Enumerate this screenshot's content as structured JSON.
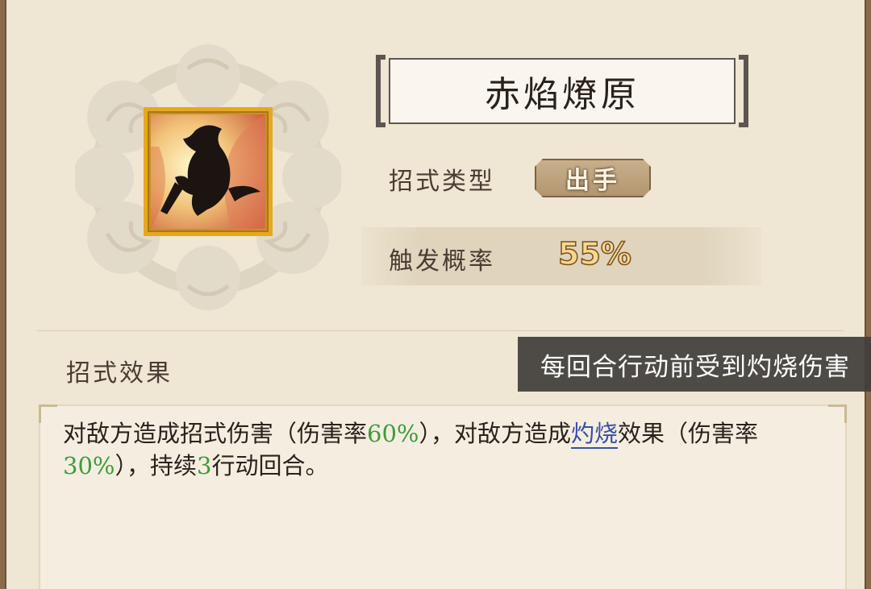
{
  "skill": {
    "name": "赤焰燎原",
    "icon": "silhouette-fire-swordsman-icon"
  },
  "type_row": {
    "label": "招式类型",
    "value": "出手"
  },
  "prob_row": {
    "label": "触发概率",
    "value": "55%"
  },
  "effect_section": {
    "label": "招式效果"
  },
  "tooltip": {
    "text": "每回合行动前受到灼烧伤害"
  },
  "description": {
    "p1": "对敌方造成招式伤害（伤害率",
    "v1": "60%",
    "p2": "），对敌方造成",
    "link": "灼烧",
    "p3": "效果（伤害率",
    "v2": "30%",
    "p4": "），持续",
    "v3": "3",
    "p5": "行动回合。"
  },
  "colors": {
    "panel_bg": "#efe6d3",
    "icon_border": "#e5a81e",
    "highlight_green": "#3c9d3a",
    "link_blue": "#3a4fa6"
  }
}
